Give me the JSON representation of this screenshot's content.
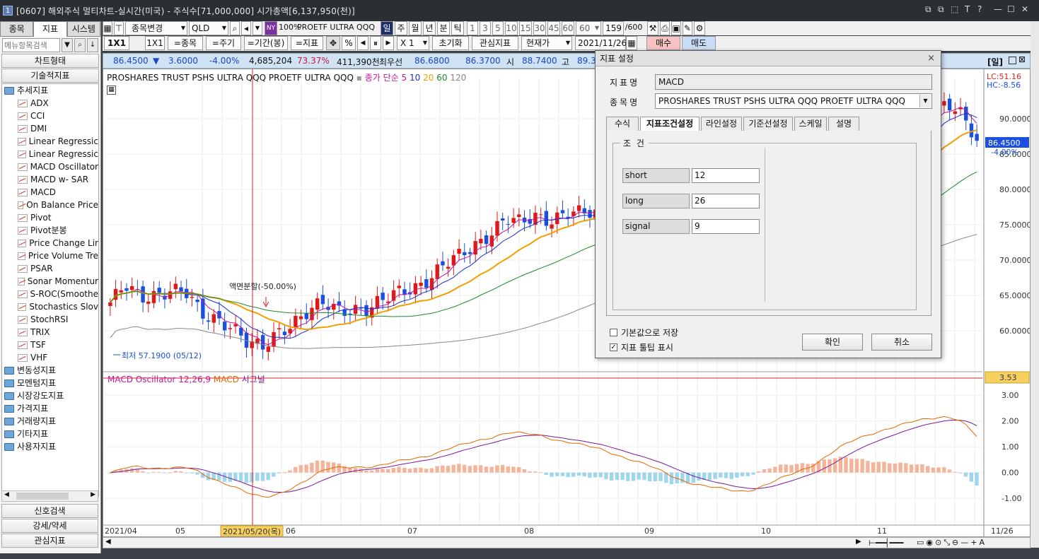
{
  "window": {
    "title": "[0607] 해외주식 멀티차트-실시간(미국) - 주식수[71,000,000] 시가총액[6,137,950(천)]",
    "number": "1",
    "controls": [
      "⧉",
      "⧉",
      "⬚",
      "T",
      "?",
      "—",
      "☐",
      "✕"
    ]
  },
  "left_panel": {
    "tabs": [
      "종목",
      "지표",
      "시스템"
    ],
    "active_tab": "지표",
    "search_placeholder": "메뉴항목검색",
    "headers": [
      "차트형태",
      "기술적지표"
    ],
    "root_folder": "추세지표",
    "indicators": [
      "ADX",
      "CCI",
      "DMI",
      "Linear Regressic",
      "Linear Regressic",
      "MACD Oscillator",
      "MACD w- SAR",
      "MACD",
      "On Balance Price",
      "Pivot",
      "Pivot분봉",
      "Price Change Lir",
      "Price Volume Tre",
      "PSAR",
      "Sonar Momentur",
      "S-ROC(Smoothe",
      "Stochastics Slov",
      "StochRSI",
      "TRIX",
      "TSF",
      "VHF"
    ],
    "folders": [
      "변동성지표",
      "모멘텀지표",
      "시장강도지표",
      "가격지표",
      "거래량지표",
      "기타지표",
      "사용자지표"
    ],
    "bottom_buttons": [
      "신호검색",
      "강세/약세",
      "관심지표"
    ]
  },
  "toolbar1": {
    "change_code": "종목변경",
    "symbol": "QLD",
    "market_badge": "NY",
    "pct": "100%",
    "name": "PROETF ULTRA QQQ",
    "periods": [
      "일",
      "주",
      "월",
      "년",
      "분",
      "틱"
    ],
    "active_period": "일",
    "numbers": [
      "1",
      "3",
      "5",
      "10",
      "15",
      "30",
      "45",
      "60"
    ],
    "n_select": "60",
    "count": "159",
    "count_max": "/600"
  },
  "toolbar2": {
    "layout1": "1X1",
    "layout2": "1X1",
    "eq_code": "=종목",
    "eq_period": "=주기",
    "eq_range": "=기간(봉)",
    "eq_ind": "=지표",
    "pct": "%",
    "multiplier": "X 1",
    "reset": "초기화",
    "watch": "관심지표",
    "current_price": "현재가",
    "date": "2021/11/26",
    "buy": "매수",
    "sell": "매도"
  },
  "quote": {
    "price": "86.4500",
    "arrow": "▼",
    "change": "3.6000",
    "change_pct": "-4.00%",
    "volume": "4,685,204",
    "vol_ratio": "73.37%",
    "amount": "411,390천",
    "best_label": "최우선",
    "ask": "86.6800",
    "bid": "86.3700",
    "open_label": "시",
    "open": "88.7400",
    "high_label": "고",
    "high": "89.3",
    "period_badge": "[일]"
  },
  "chart_legend": {
    "name": "PROSHARES TRUST PSHS ULTRA QQQ  PROETF ULTRA QQQ",
    "ma_label": "종가 단순",
    "ma_periods": [
      "5",
      "10",
      "20",
      "60",
      "120"
    ],
    "ma_colors": [
      "#c0189a",
      "#1a2fd0",
      "#f0a000",
      "#1a8a2a",
      "#888888"
    ]
  },
  "chart_annotations": {
    "split": "액면분할(-50.00%)",
    "low": "최저 57.1900 (05/12)",
    "lc": "LC:51.16",
    "hc": "HC:-8.56",
    "last_price": "86.4500",
    "last_pct": "-4.00%"
  },
  "macd_legend": {
    "osc": "MACD Oscillator 12,26,9",
    "macd": "MACD",
    "signal": "시그널",
    "current": "3.53"
  },
  "chart_data": [
    {
      "type": "candlestick",
      "title": "PROSHARES TRUST PSHS ULTRA QQQ  PROETF ULTRA QQQ",
      "x_labels": [
        "2021/04",
        "05",
        "06",
        "07",
        "08",
        "09",
        "10",
        "11",
        "11/26"
      ],
      "y_ticks": [
        "90.0000",
        "85.0000",
        "80.0000",
        "75.0000",
        "70.0000",
        "65.0000",
        "60.0000"
      ],
      "ylim": [
        55,
        95
      ],
      "close_path": [
        64,
        66,
        64.5,
        65.5,
        66,
        65,
        62,
        62,
        61,
        58,
        57.19,
        60,
        61.5,
        62.5,
        63.5,
        63,
        63.5,
        63,
        64,
        65.5,
        66.5,
        67.5,
        69,
        70.5,
        72.5,
        74,
        75.5,
        75,
        76.5,
        76,
        76.5,
        76.2,
        76.8,
        76.3,
        75.5,
        74.5,
        73.5,
        72.5,
        71.5,
        70.5,
        70,
        69.5,
        70,
        71,
        72,
        73.5,
        75,
        77.5,
        79.5,
        81.5,
        83.5,
        85,
        86.5,
        89,
        91,
        92.5,
        90.05,
        86.45
      ]
    },
    {
      "type": "line",
      "title": "MACD Oscillator 12,26,9",
      "series": [
        {
          "name": "MACD",
          "color": "#e06a00"
        },
        {
          "name": "시그널",
          "color": "#7a1a9a"
        }
      ],
      "y_ticks": [
        "3.00",
        "2.00",
        "1.00",
        "0.00",
        "-1.00"
      ],
      "ylim": [
        -1.9,
        3.8
      ]
    }
  ],
  "date_cursor": "2021/05/20(목)",
  "dialog": {
    "title": "지표 설정",
    "close": "×",
    "indicator_label": "지표명",
    "indicator_value": "MACD",
    "symbol_label": "종목명",
    "symbol_value": "PROSHARES TRUST PSHS ULTRA QQQ  PROETF ULTRA QQQ",
    "tabs": [
      "수식",
      "지표조건설정",
      "라인설정",
      "기준선설정",
      "스케일",
      "설명"
    ],
    "active_tab": "지표조건설정",
    "group_title": "조 건",
    "params": [
      {
        "label": "short",
        "value": "12"
      },
      {
        "label": "long",
        "value": "26"
      },
      {
        "label": "signal",
        "value": "9"
      }
    ],
    "save_default": "기본값으로 저장",
    "save_default_checked": false,
    "tooltip": "지표 툴팁 표시",
    "tooltip_checked": true,
    "ok": "확인",
    "cancel": "취소"
  }
}
